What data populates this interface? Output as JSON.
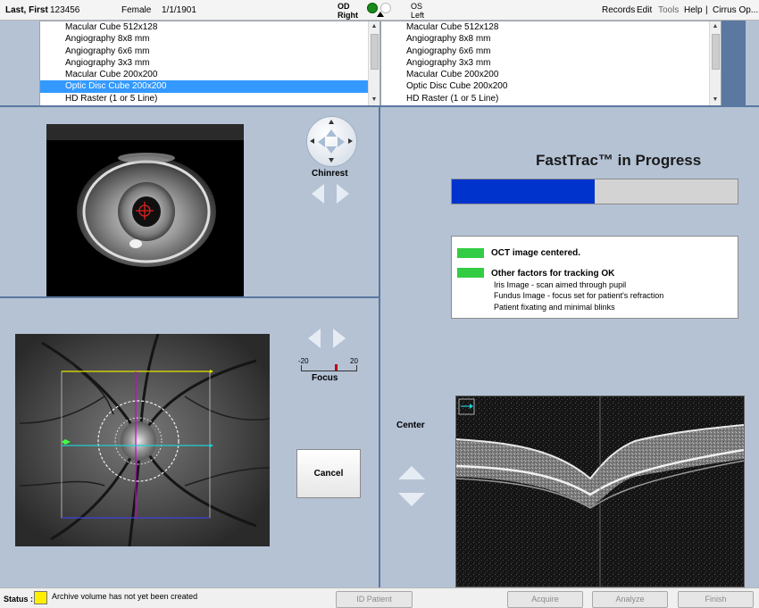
{
  "header": {
    "patient_name": "Last, First",
    "patient_id": "123456",
    "gender": "Female",
    "dob": "1/1/1901",
    "od_label": "OD",
    "od_sub": "Right",
    "os_label": "OS",
    "os_sub": "Left",
    "menu": [
      "Records",
      "Edit",
      "Tools",
      "Help"
    ],
    "app_title": "Cirrus Op..."
  },
  "scan_list_od": {
    "items": [
      "Macular Cube 512x128",
      "Angiography 8x8 mm",
      "Angiography 6x6 mm",
      "Angiography 3x3 mm",
      "Macular Cube 200x200",
      "Optic Disc Cube 200x200",
      "HD Raster (1 or 5 Line)"
    ],
    "selected_index": 5
  },
  "scan_list_os": {
    "items": [
      "Macular Cube 512x128",
      "Angiography 8x8 mm",
      "Angiography 6x6 mm",
      "Angiography 3x3 mm",
      "Macular Cube 200x200",
      "Optic Disc Cube 200x200",
      "HD Raster (1 or 5 Line)"
    ]
  },
  "chinrest": {
    "label": "Chinrest"
  },
  "focus": {
    "label": "Focus",
    "min": "-20",
    "max": "20",
    "value": 5
  },
  "center": {
    "label": "Center"
  },
  "fasttrac": {
    "title": "FastTrac™ in Progress",
    "progress": 0.5
  },
  "status_box": {
    "item1": "OCT image centered.",
    "item2": "Other factors for tracking OK",
    "details": [
      "Iris Image - scan aimed through pupil",
      "Fundus Image - focus set for patient's refraction",
      "Patient fixating and minimal blinks"
    ],
    "indicator_color": "#33cc44"
  },
  "buttons": {
    "cancel": "Cancel",
    "id_patient": "ID Patient",
    "acquire": "Acquire",
    "analyze": "Analyze",
    "finish": "Finish"
  },
  "statusbar": {
    "label": "Status :",
    "message": "Archive volume has not yet been created",
    "indicator_color": "#ffee00"
  }
}
